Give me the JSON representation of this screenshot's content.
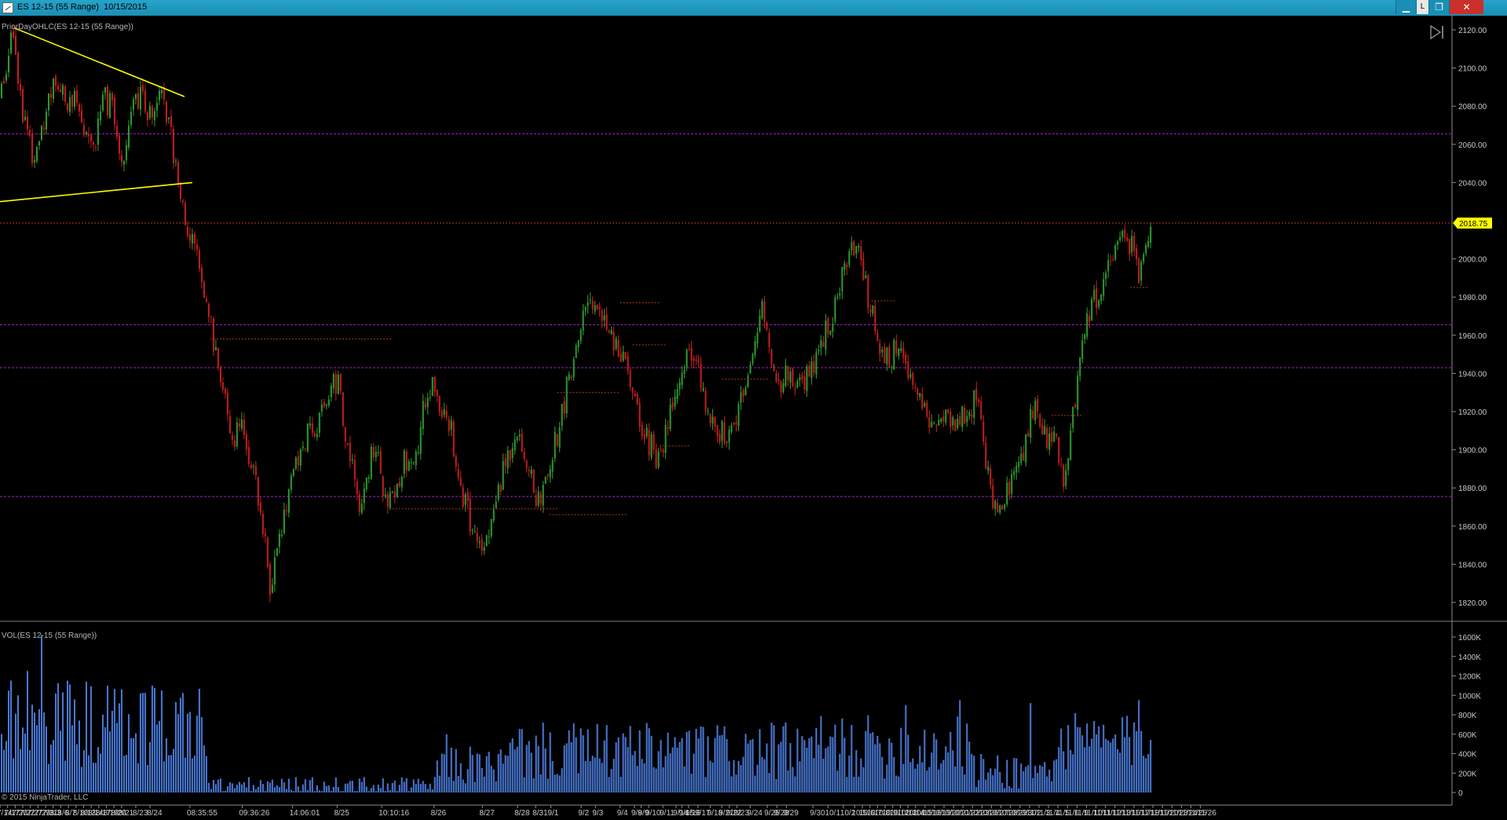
{
  "window": {
    "title": "ES 12-15 (55 Range)  10/15/2015",
    "lock_label": "L",
    "minimize_symbol": "▁",
    "restore_symbol": "❐",
    "close_symbol": "✕"
  },
  "colors": {
    "background": "#000000",
    "up_bar": "#2e9e2e",
    "down_bar": "#c81e1e",
    "volume": "#4a7ad8",
    "support_line": "#a020c8",
    "trendline": "#ffff00",
    "price_marker": "#ffff00",
    "last_price_line": "#b43c1e"
  },
  "chart_data": [
    {
      "type": "candlestick",
      "indicator_label": "PriorDayOHLC(ES 12-15 (55 Range))",
      "ylim": [
        1810,
        2125
      ],
      "yticks": [
        2120,
        2100,
        2080,
        2060,
        2040,
        2020,
        2000,
        1980,
        1960,
        1940,
        1920,
        1900,
        1880,
        1860,
        1840,
        1820
      ],
      "ytick_labels": [
        "2120.00",
        "2100.00",
        "2080.00",
        "2060.00",
        "2040.00",
        "2000.00",
        "1980.00",
        "1960.00",
        "1940.00",
        "1920.00",
        "1900.00",
        "1880.00",
        "1860.00",
        "1840.00",
        "1820.00"
      ],
      "last_price": 2018.75,
      "last_price_label": "2018.75",
      "horizontal_lines": [
        2065.5,
        1965.5,
        1943.0,
        1875.5
      ],
      "trendlines": [
        {
          "from": [
            18,
            2121
          ],
          "to": [
            235,
            2085
          ]
        },
        {
          "from": [
            0,
            2030
          ],
          "to": [
            245,
            2040
          ]
        }
      ],
      "price_path": [
        [
          0,
          2085
        ],
        [
          8,
          2095
        ],
        [
          14,
          2118
        ],
        [
          22,
          2098
        ],
        [
          30,
          2075
        ],
        [
          38,
          2060
        ],
        [
          46,
          2052
        ],
        [
          54,
          2068
        ],
        [
          64,
          2090
        ],
        [
          76,
          2093
        ],
        [
          88,
          2078
        ],
        [
          96,
          2088
        ],
        [
          104,
          2075
        ],
        [
          112,
          2060
        ],
        [
          122,
          2065
        ],
        [
          132,
          2085
        ],
        [
          140,
          2080
        ],
        [
          148,
          2070
        ],
        [
          154,
          2042
        ],
        [
          162,
          2062
        ],
        [
          170,
          2080
        ],
        [
          180,
          2088
        ],
        [
          188,
          2072
        ],
        [
          196,
          2080
        ],
        [
          206,
          2085
        ],
        [
          214,
          2070
        ],
        [
          222,
          2055
        ],
        [
          230,
          2035
        ],
        [
          238,
          2018
        ],
        [
          248,
          2005
        ],
        [
          258,
          1990
        ],
        [
          268,
          1970
        ],
        [
          278,
          1940
        ],
        [
          290,
          1920
        ],
        [
          300,
          1905
        ],
        [
          308,
          1922
        ],
        [
          316,
          1900
        ],
        [
          326,
          1880
        ],
        [
          336,
          1855
        ],
        [
          344,
          1828
        ],
        [
          350,
          1838
        ],
        [
          358,
          1860
        ],
        [
          366,
          1875
        ],
        [
          376,
          1888
        ],
        [
          386,
          1902
        ],
        [
          396,
          1918
        ],
        [
          404,
          1908
        ],
        [
          414,
          1925
        ],
        [
          422,
          1936
        ],
        [
          430,
          1935
        ],
        [
          440,
          1910
        ],
        [
          450,
          1890
        ],
        [
          458,
          1872
        ],
        [
          468,
          1885
        ],
        [
          478,
          1905
        ],
        [
          488,
          1880
        ],
        [
          496,
          1872
        ],
        [
          506,
          1882
        ],
        [
          516,
          1895
        ],
        [
          526,
          1888
        ],
        [
          534,
          1905
        ],
        [
          542,
          1928
        ],
        [
          552,
          1935
        ],
        [
          562,
          1922
        ],
        [
          572,
          1915
        ],
        [
          582,
          1895
        ],
        [
          592,
          1872
        ],
        [
          602,
          1860
        ],
        [
          612,
          1850
        ],
        [
          622,
          1858
        ],
        [
          632,
          1872
        ],
        [
          642,
          1890
        ],
        [
          652,
          1902
        ],
        [
          662,
          1910
        ],
        [
          672,
          1895
        ],
        [
          682,
          1875
        ],
        [
          690,
          1872
        ],
        [
          700,
          1890
        ],
        [
          708,
          1905
        ],
        [
          716,
          1918
        ],
        [
          726,
          1940
        ],
        [
          736,
          1960
        ],
        [
          746,
          1975
        ],
        [
          756,
          1980
        ],
        [
          766,
          1975
        ],
        [
          776,
          1962
        ],
        [
          786,
          1955
        ],
        [
          796,
          1945
        ],
        [
          806,
          1932
        ],
        [
          816,
          1915
        ],
        [
          826,
          1905
        ],
        [
          836,
          1896
        ],
        [
          846,
          1905
        ],
        [
          856,
          1920
        ],
        [
          866,
          1935
        ],
        [
          876,
          1952
        ],
        [
          886,
          1945
        ],
        [
          896,
          1930
        ],
        [
          906,
          1918
        ],
        [
          916,
          1910
        ],
        [
          926,
          1905
        ],
        [
          936,
          1915
        ],
        [
          946,
          1925
        ],
        [
          956,
          1940
        ],
        [
          964,
          1955
        ],
        [
          972,
          1980
        ],
        [
          978,
          1960
        ],
        [
          986,
          1940
        ],
        [
          996,
          1935
        ],
        [
          1006,
          1945
        ],
        [
          1016,
          1930
        ],
        [
          1026,
          1938
        ],
        [
          1036,
          1945
        ],
        [
          1046,
          1958
        ],
        [
          1056,
          1965
        ],
        [
          1066,
          1980
        ],
        [
          1076,
          1998
        ],
        [
          1086,
          2002
        ],
        [
          1094,
          2008
        ],
        [
          1104,
          1985
        ],
        [
          1114,
          1965
        ],
        [
          1124,
          1952
        ],
        [
          1134,
          1945
        ],
        [
          1144,
          1958
        ],
        [
          1154,
          1945
        ],
        [
          1164,
          1930
        ],
        [
          1174,
          1925
        ],
        [
          1184,
          1918
        ],
        [
          1194,
          1910
        ],
        [
          1204,
          1922
        ],
        [
          1214,
          1915
        ],
        [
          1224,
          1920
        ],
        [
          1234,
          1920
        ],
        [
          1244,
          1930
        ],
        [
          1252,
          1905
        ],
        [
          1262,
          1880
        ],
        [
          1270,
          1866
        ],
        [
          1278,
          1875
        ],
        [
          1286,
          1880
        ],
        [
          1296,
          1888
        ],
        [
          1306,
          1904
        ],
        [
          1316,
          1922
        ],
        [
          1326,
          1918
        ],
        [
          1334,
          1905
        ],
        [
          1344,
          1912
        ],
        [
          1350,
          1895
        ],
        [
          1356,
          1882
        ],
        [
          1364,
          1905
        ],
        [
          1372,
          1935
        ],
        [
          1380,
          1960
        ],
        [
          1390,
          1975
        ],
        [
          1400,
          1980
        ],
        [
          1410,
          1990
        ],
        [
          1418,
          2000
        ],
        [
          1426,
          2008
        ],
        [
          1434,
          2010
        ],
        [
          1444,
          2004
        ],
        [
          1452,
          1990
        ],
        [
          1460,
          2005
        ],
        [
          1466,
          2018
        ]
      ]
    },
    {
      "type": "bar",
      "indicator_label": "VOL(ES 12-15 (55 Range))",
      "ylim": [
        0,
        1700000
      ],
      "yticks": [
        1600000,
        1400000,
        1200000,
        1000000,
        800000,
        600000,
        400000,
        200000,
        0
      ],
      "ytick_labels": [
        "1600K",
        "1400K",
        "1200K",
        "1000K",
        "800K",
        "600K",
        "400K",
        "200K",
        "0"
      ],
      "segments": [
        {
          "from": 0,
          "to": 265,
          "level": 700000,
          "jitter": 450000
        },
        {
          "from": 265,
          "to": 555,
          "level": 70000,
          "jitter": 90000
        },
        {
          "from": 555,
          "to": 650,
          "level": 280000,
          "jitter": 200000
        },
        {
          "from": 650,
          "to": 1040,
          "level": 420000,
          "jitter": 300000
        },
        {
          "from": 1040,
          "to": 1240,
          "level": 470000,
          "jitter": 330000
        },
        {
          "from": 1240,
          "to": 1345,
          "level": 220000,
          "jitter": 200000
        },
        {
          "from": 1345,
          "to": 1466,
          "level": 520000,
          "jitter": 300000
        }
      ],
      "spikes": [
        [
          14,
          1150000
        ],
        [
          24,
          1000000
        ],
        [
          36,
          1250000
        ],
        [
          52,
          1620000
        ],
        [
          86,
          1150000
        ],
        [
          194,
          1100000
        ],
        [
          570,
          600000
        ],
        [
          1154,
          900000
        ],
        [
          1224,
          950000
        ],
        [
          1314,
          920000
        ],
        [
          1450,
          950000
        ]
      ]
    }
  ],
  "x_axis_labels": [
    "7/14",
    "7/17",
    "7/20",
    "7/22",
    "7/27",
    "7/29",
    "7/31",
    "8/3",
    "8/6",
    "8/7",
    "8/10",
    "8/13",
    "8/14",
    "8/17",
    "8/19",
    "8/20",
    "8/21",
    "8/23",
    "8/24",
    "08:35:55",
    "09:36:26",
    "14:06:01",
    "8/25",
    "10:10:16",
    "8/26",
    "8/27",
    "8/28",
    "8/31",
    "9/1",
    "9/2",
    "9/3",
    "9/4",
    "9/8",
    "9/9",
    "9/10",
    "9/11",
    "9/14",
    "9/15",
    "9/16",
    "9/17",
    "9/18",
    "9/21",
    "9/22",
    "9/23",
    "9/24",
    "9/25",
    "9/28",
    "9/29",
    "9/30",
    "10/1",
    "10/2",
    "10/5",
    "10/6",
    "10/7",
    "10/8",
    "10/9",
    "10/12",
    "10/13",
    "10/14",
    "10/15",
    "10/16",
    "10/19",
    "10/20",
    "10/21",
    "10/22",
    "10/23",
    "10/26",
    "10/27",
    "10/28",
    "10/29",
    "10/30",
    "11/2",
    "11/3",
    "11/4",
    "11/5",
    "11/6",
    "11/9",
    "11/10",
    "11/11",
    "11/12",
    "11/13",
    "11/16",
    "11/17",
    "11/18",
    "11/19",
    "11/20",
    "11/23",
    "11/24",
    "11/25",
    "11/26"
  ],
  "copyright": "© 2015 NinjaTrader, LLC",
  "ui": {
    "scroll_end_icon": "▷|"
  }
}
